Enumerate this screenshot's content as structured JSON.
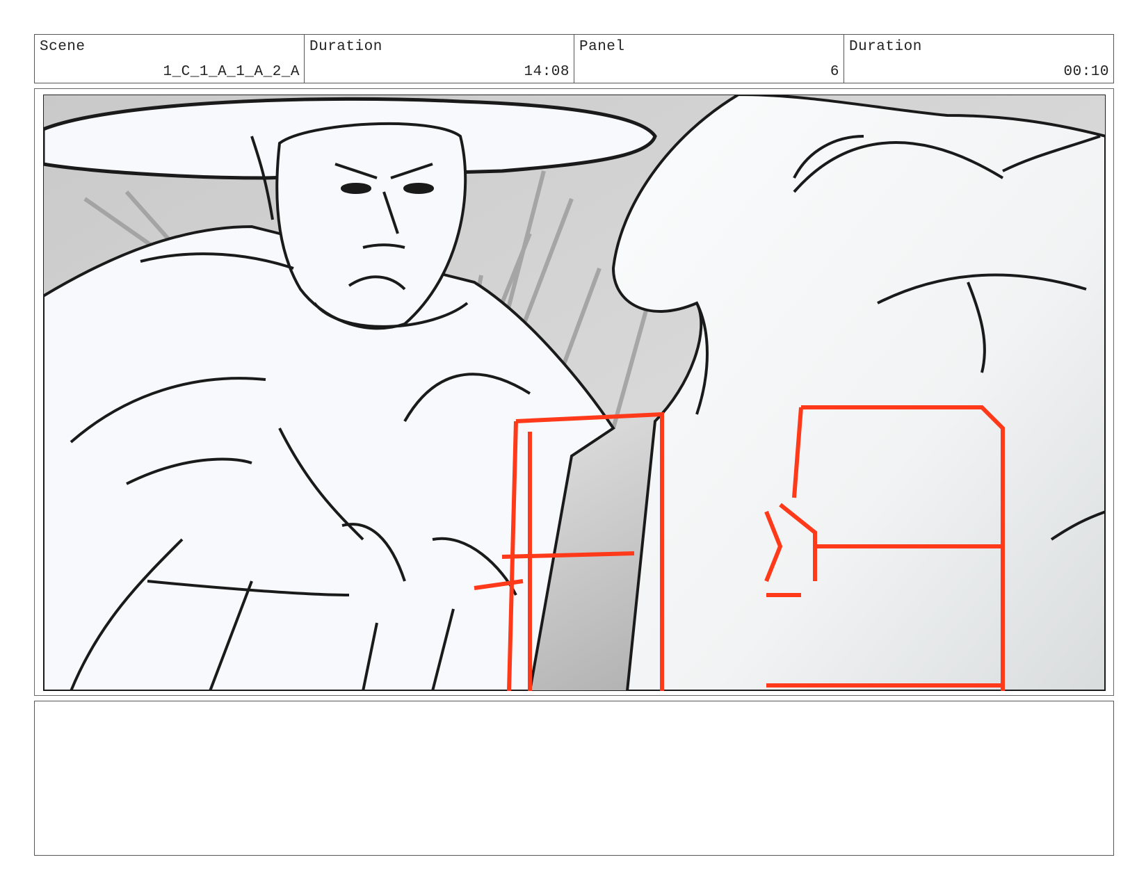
{
  "header": {
    "scene_label": "Scene",
    "scene_value": "1_C_1_A_1_A_2_A",
    "duration_label": "Duration",
    "duration_value": "14:08",
    "panel_label": "Panel",
    "panel_value": "6",
    "panel_duration_label": "Duration",
    "panel_duration_value": "00:10"
  },
  "panel": {
    "content": "storyboard sketch",
    "colors": {
      "sketch_line": "#1a1a1a",
      "accent_line": "#ff3a1a",
      "background_gray": "#cfcfcf",
      "figure_fill": "#f8f9fc"
    }
  },
  "notes": {
    "text": ""
  }
}
